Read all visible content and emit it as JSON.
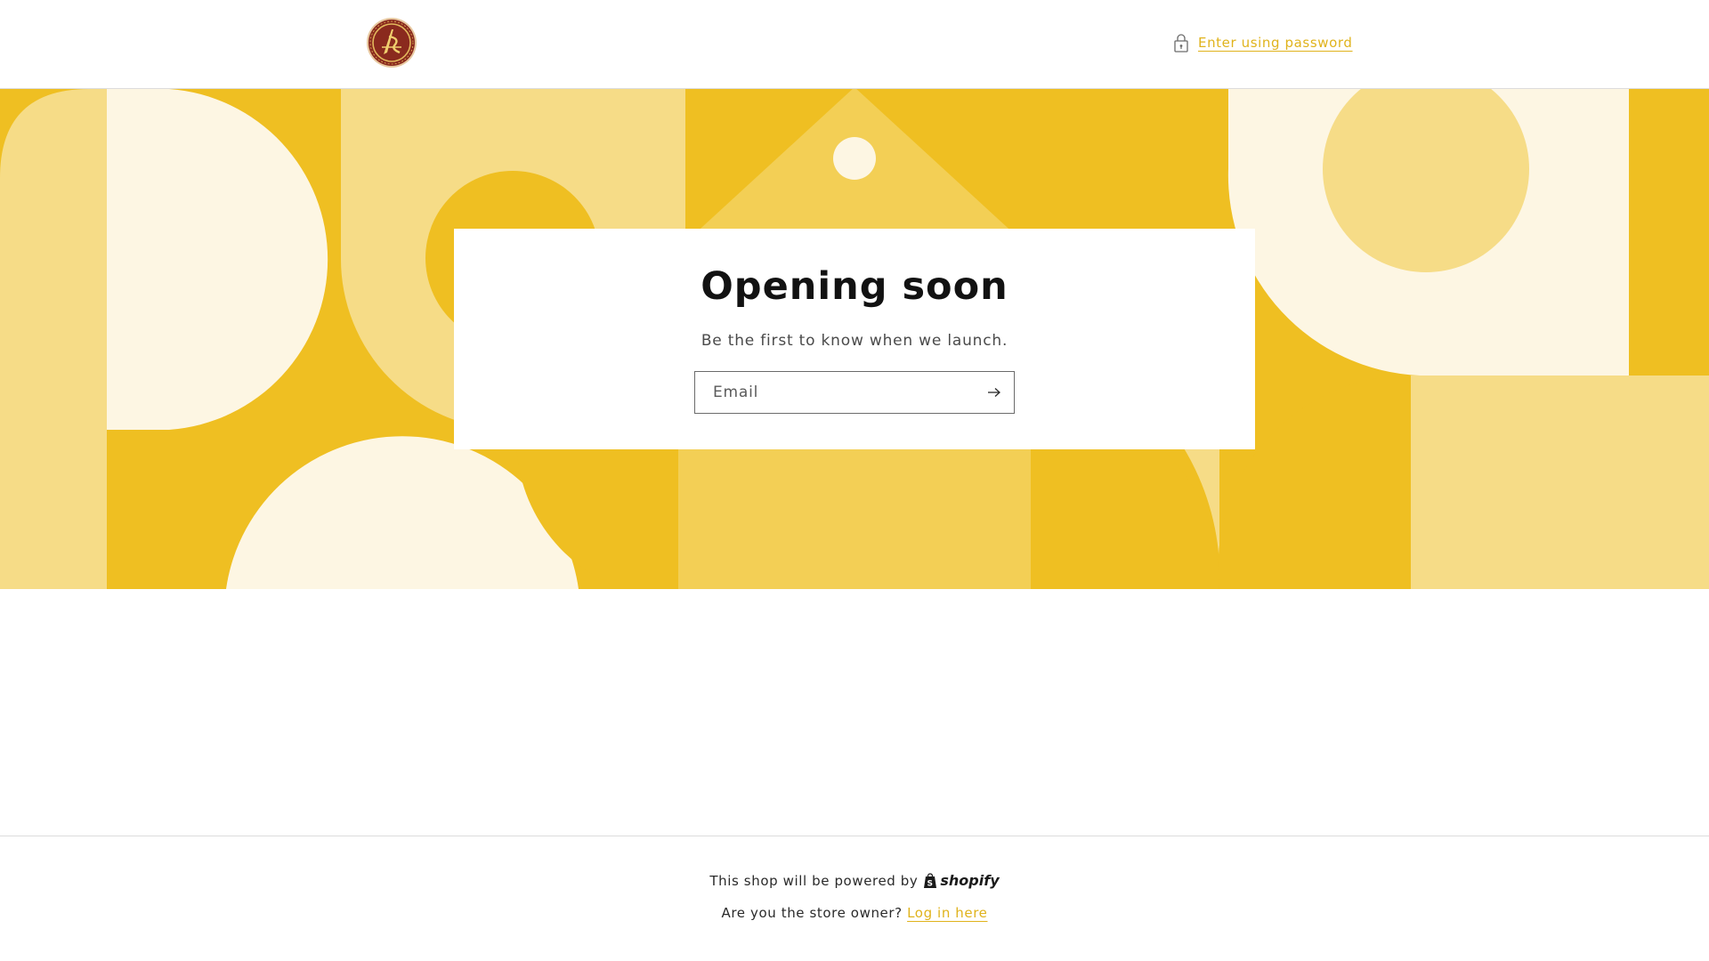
{
  "header": {
    "logo_alt": "Store logo",
    "password_link": "Enter using password"
  },
  "hero": {
    "title": "Opening soon",
    "subtitle": "Be the first to know when we launch.",
    "email_placeholder": "Email",
    "email_value": ""
  },
  "footer": {
    "powered_text": "This shop will be powered by",
    "shopify_word": "shopify",
    "owner_text": "Are you the store owner?",
    "login_link": "Log in here"
  },
  "colors": {
    "accent": "#e0b31c",
    "yellow_dark": "#efbf22",
    "yellow_mid": "#f3cf55",
    "yellow_light": "#f6dc87",
    "cream": "#fdf6e3"
  }
}
